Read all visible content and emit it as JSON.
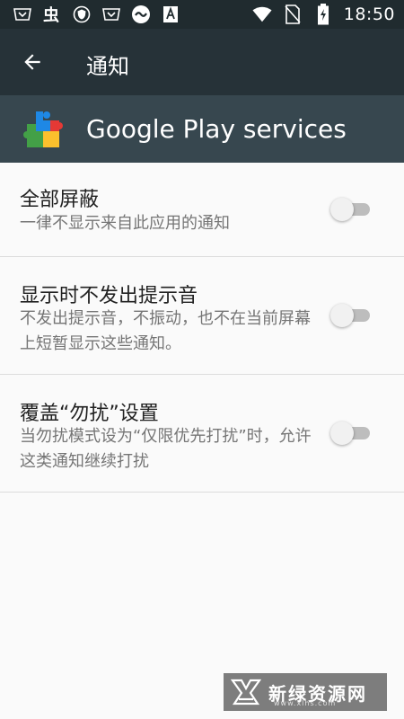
{
  "status_bar": {
    "time": "18:50",
    "left_icons": [
      "notification-app-icon",
      "notification-app-icon",
      "shield-icon",
      "notification-app-icon",
      "cast-icon",
      "notification-app-icon"
    ],
    "right_icons": [
      "wifi-icon",
      "no-sim-icon",
      "battery-charging-icon"
    ]
  },
  "toolbar": {
    "title": "通知",
    "back_icon": "arrow-back-icon"
  },
  "app_header": {
    "app_name": "Google Play services",
    "app_icon": "google-play-services-icon"
  },
  "settings": [
    {
      "title": "全部屏蔽",
      "summary": "一律不显示来自此应用的通知",
      "enabled": false
    },
    {
      "title": "显示时不发出提示音",
      "summary": "不发出提示音，不振动，也不在当前屏幕上短暂显示这些通知。",
      "enabled": false
    },
    {
      "title": "覆盖“勿扰”设置",
      "summary": "当勿扰模式设为“仅限优先打扰”时，允许这类通知继续打扰",
      "enabled": false
    }
  ],
  "watermark": {
    "text": "新绿资源网",
    "url": "www.xlhs.com"
  },
  "colors": {
    "status_bar": "#202b2f",
    "toolbar": "#263238",
    "app_header": "#37474f",
    "background": "#fafafa",
    "switch_off_track": "#bdbdbd",
    "switch_off_thumb": "#f1f1f1"
  }
}
